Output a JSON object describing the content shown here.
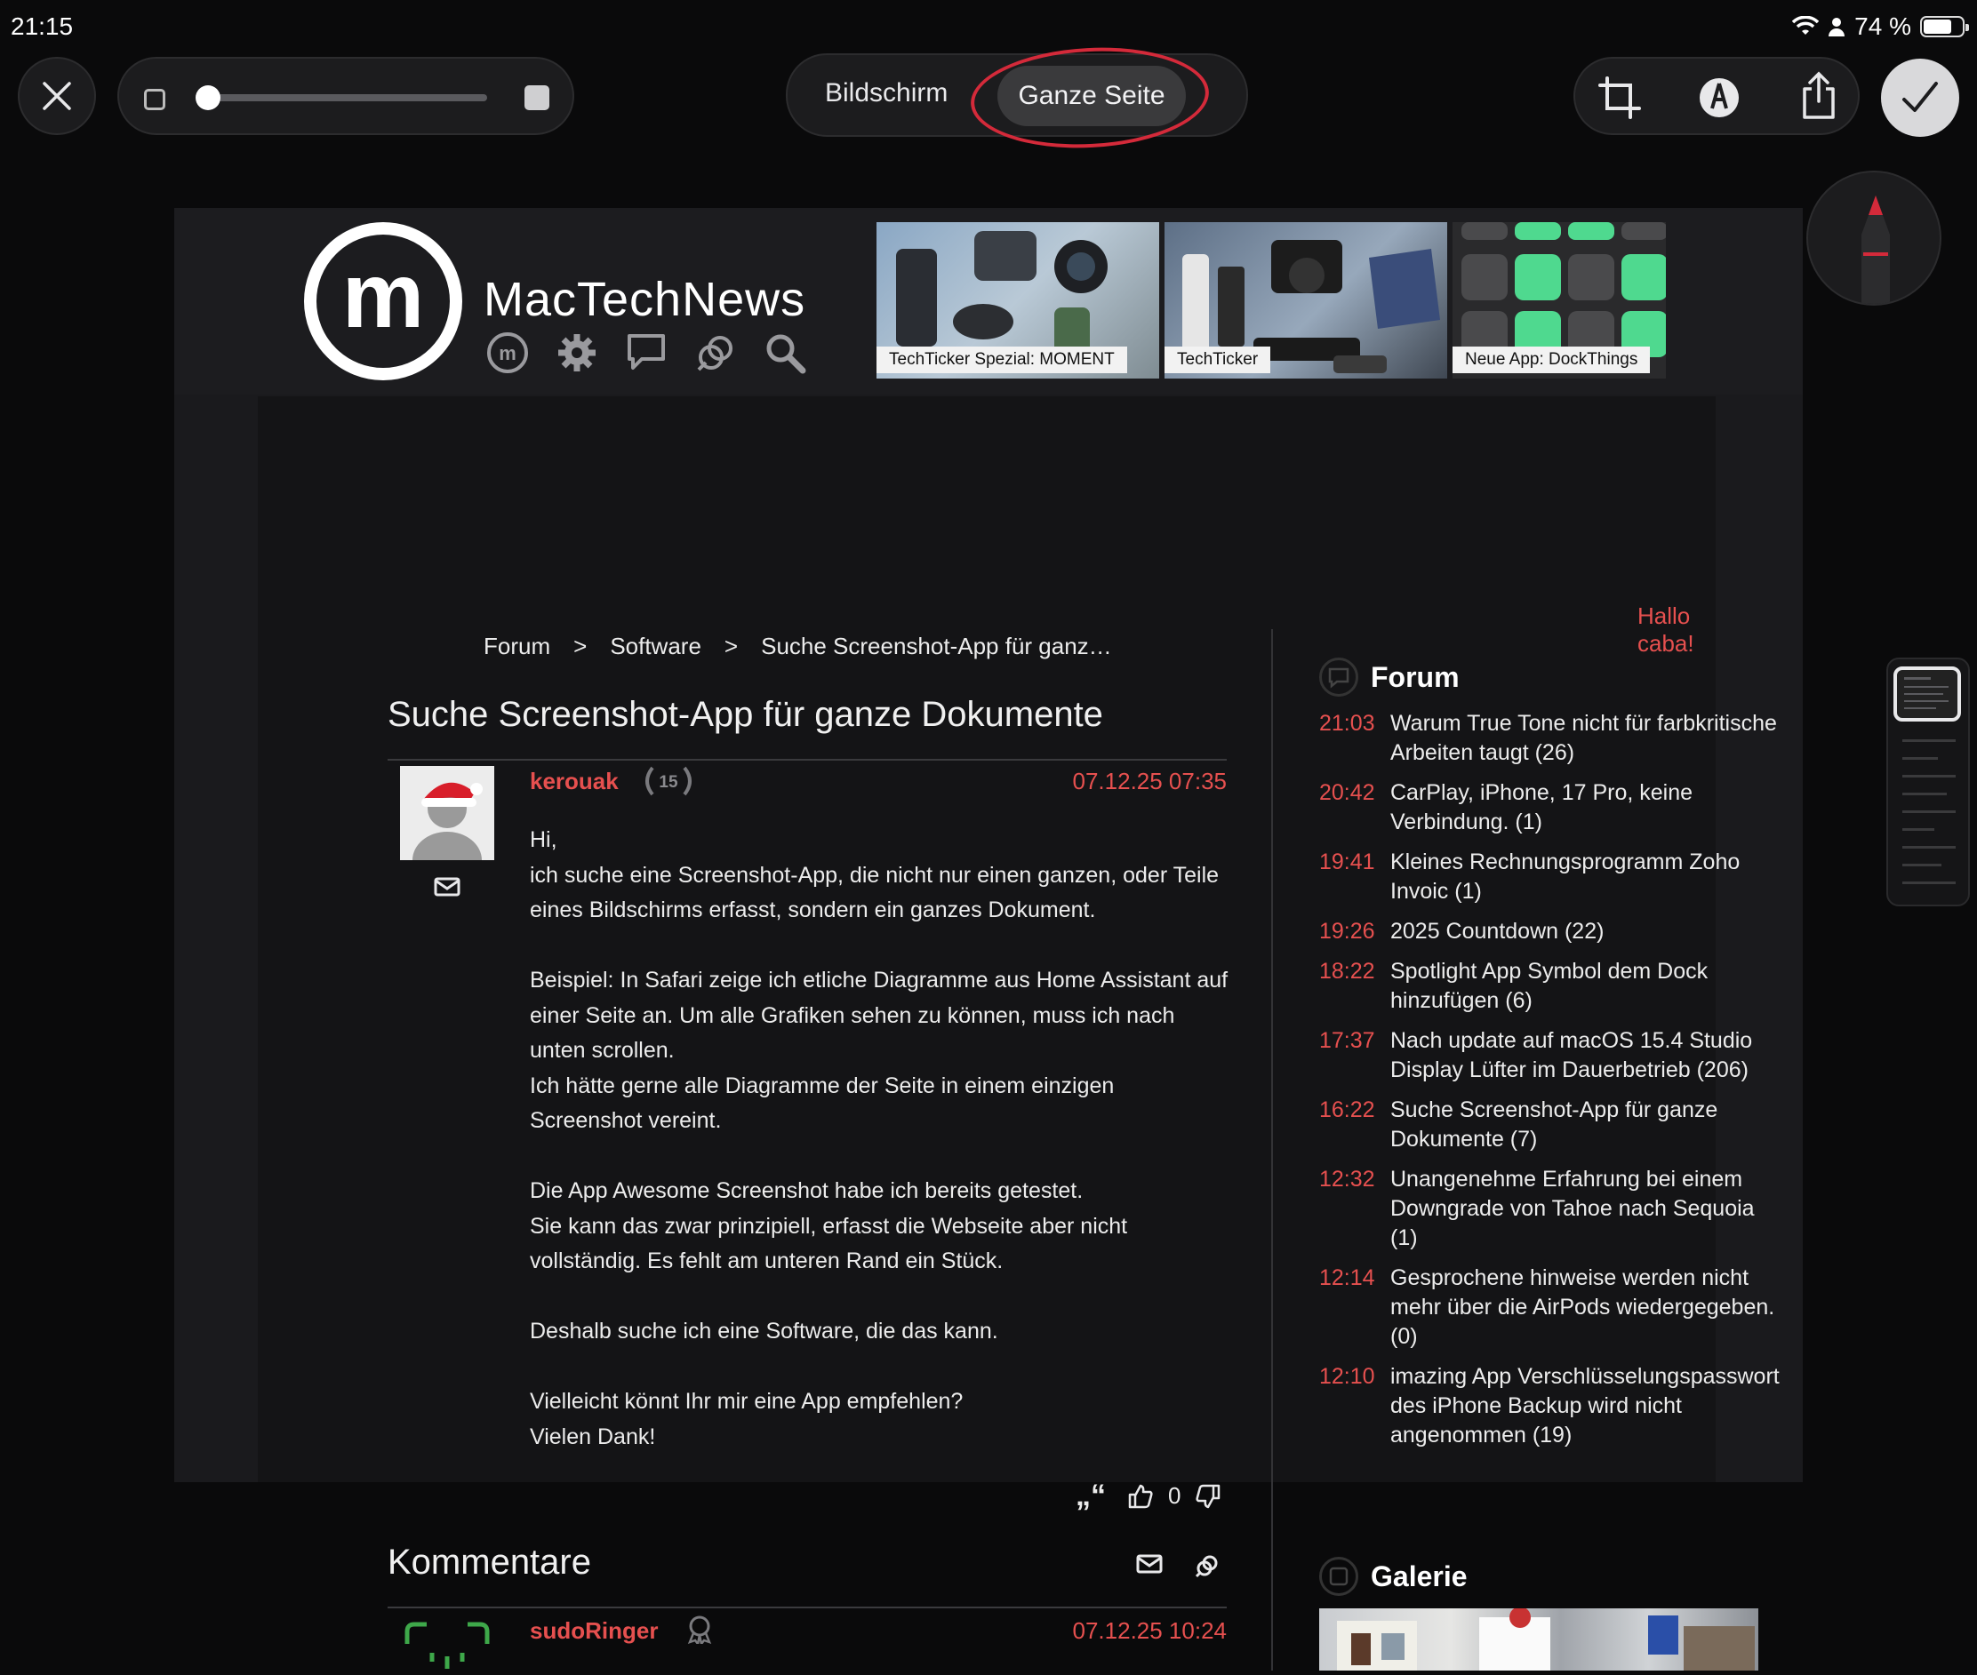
{
  "status": {
    "time": "21:15",
    "battery": "74 %",
    "battery_level": 0.74
  },
  "toolbar": {
    "close_icon": "close-icon",
    "segments": {
      "screen": "Bildschirm",
      "full_page": "Ganze Seite",
      "selected": "Ganze Seite"
    },
    "slider_position": 0.0,
    "tools": [
      "crop-icon",
      "markup-icon",
      "share-icon"
    ],
    "done_icon": "checkmark-icon",
    "annotation_color": "#d42a3a"
  },
  "site": {
    "logo_letter": "m",
    "name": "MacTechNews",
    "banners": [
      {
        "caption": "TechTicker Spezial: MOMENT"
      },
      {
        "caption": "TechTicker"
      },
      {
        "caption": "Neue App: DockThings"
      }
    ],
    "greeting": "Hallo caba!"
  },
  "breadcrumb": {
    "items": [
      "Forum",
      "Software",
      "Suche Screenshot-App für ganz…"
    ],
    "separator": ">"
  },
  "post": {
    "title": "Suche Screenshot-App für ganze Dokumente",
    "author": "kerouak",
    "badge": "15",
    "date": "07.12.25 07:35",
    "paragraphs": [
      "Hi,\nich suche eine Screenshot-App, die nicht nur einen ganzen, oder Teile eines Bildschirms erfasst, sondern ein ganzes Dokument.",
      "Beispiel: In Safari zeige ich etliche Diagramme aus Home Assistant auf einer Seite an. Um alle Grafiken sehen zu können, muss ich nach unten scrollen.\nIch hätte gerne alle Diagramme der Seite in einem einzigen Screenshot vereint.",
      "Die App Awesome Screenshot habe ich bereits getestet.\nSie kann das zwar prinzipiell, erfasst die Webseite aber nicht vollständig. Es fehlt am unteren Rand ein Stück.",
      "Deshalb suche ich eine Software, die das kann.",
      "Vielleicht könnt Ihr mir eine App empfehlen?\nVielen Dank!"
    ],
    "quote_glyph": "„“",
    "votes": "0"
  },
  "comments": {
    "title": "Kommentare",
    "first": {
      "author": "sudoRinger",
      "date": "07.12.25 10:24"
    }
  },
  "sidebar": {
    "forum_title": "Forum",
    "forum_items": [
      {
        "time": "21:03",
        "text": "Warum True Tone nicht für farbkritische Arbeiten taugt  (26)"
      },
      {
        "time": "20:42",
        "text": "CarPlay, iPhone, 17 Pro, keine Verbindung.  (1)"
      },
      {
        "time": "19:41",
        "text": "Kleines Rechnungsprogramm Zoho Invoic  (1)"
      },
      {
        "time": "19:26",
        "text": "2025 Countdown  (22)"
      },
      {
        "time": "18:22",
        "text": "Spotlight App Symbol dem Dock hinzufügen  (6)"
      },
      {
        "time": "17:37",
        "text": "Nach update auf macOS 15.4 Studio Display Lüfter im Dauerbetrieb  (206)"
      },
      {
        "time": "16:22",
        "text": "Suche Screenshot-App für ganze Dokumente  (7)"
      },
      {
        "time": "12:32",
        "text": "Unangenehme Erfahrung bei einem Downgrade von Tahoe nach Sequoia  (1)"
      },
      {
        "time": "12:14",
        "text": "Gesprochene hinweise werden nicht mehr über die AirPods wiedergegeben.  (0)"
      },
      {
        "time": "12:10",
        "text": "imazing App Verschlüsselungspasswort des iPhone Backup wird nicht angenommen  (19)"
      }
    ],
    "gallery_title": "Galerie"
  },
  "colors": {
    "accent": "#e6504f",
    "background": "#0a0a0b",
    "page": "#141416"
  }
}
